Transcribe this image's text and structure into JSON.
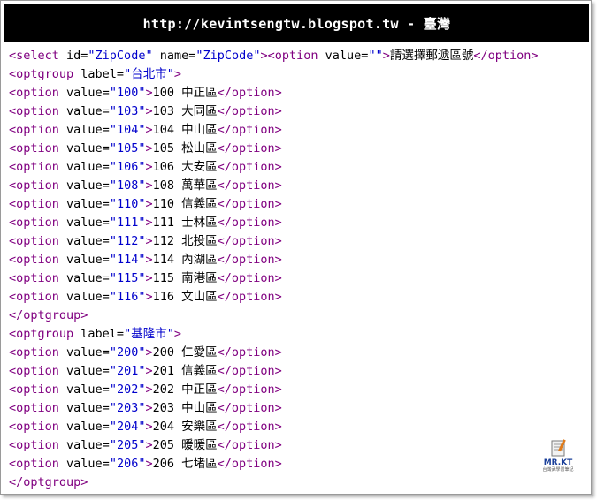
{
  "header": {
    "title": "http://kevintsengtw.blogspot.tw - 臺灣"
  },
  "code": {
    "select_open": {
      "tag": "select",
      "id_attr": "id",
      "id_value": "ZipCode",
      "name_attr": "name",
      "name_value": "ZipCode",
      "option_value": "",
      "option_text": "請選擇郵遞區號"
    },
    "groups": [
      {
        "label": "台北市",
        "options": [
          {
            "value": "100",
            "text": "100 中正區"
          },
          {
            "value": "103",
            "text": "103 大同區"
          },
          {
            "value": "104",
            "text": "104 中山區"
          },
          {
            "value": "105",
            "text": "105 松山區"
          },
          {
            "value": "106",
            "text": "106 大安區"
          },
          {
            "value": "108",
            "text": "108 萬華區"
          },
          {
            "value": "110",
            "text": "110 信義區"
          },
          {
            "value": "111",
            "text": "111 士林區"
          },
          {
            "value": "112",
            "text": "112 北投區"
          },
          {
            "value": "114",
            "text": "114 內湖區"
          },
          {
            "value": "115",
            "text": "115 南港區"
          },
          {
            "value": "116",
            "text": "116 文山區"
          }
        ]
      },
      {
        "label": "基隆市",
        "options": [
          {
            "value": "200",
            "text": "200 仁愛區"
          },
          {
            "value": "201",
            "text": "201 信義區"
          },
          {
            "value": "202",
            "text": "202 中正區"
          },
          {
            "value": "203",
            "text": "203 中山區"
          },
          {
            "value": "204",
            "text": "204 安樂區"
          },
          {
            "value": "205",
            "text": "205 暖暖區"
          },
          {
            "value": "206",
            "text": "206 七堵區"
          }
        ]
      }
    ]
  },
  "logo": {
    "title": "MR.KT",
    "subtitle": "台灣武學習筆記"
  },
  "colors": {
    "tag": "#800080",
    "attr_value": "#0000cc",
    "header_bg": "#000000"
  }
}
